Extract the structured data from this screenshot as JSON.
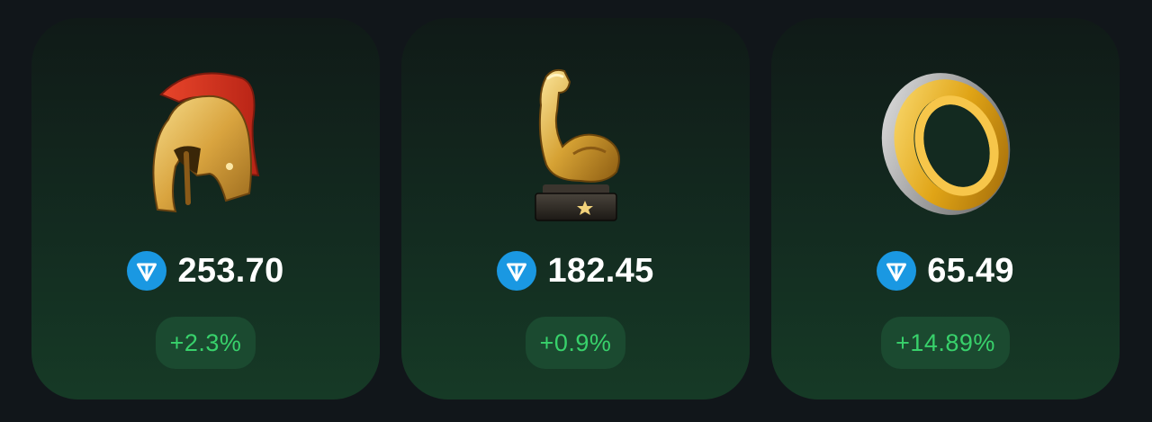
{
  "items": [
    {
      "icon": "spartan-helmet-icon",
      "price": "253.70",
      "change": "+2.3%"
    },
    {
      "icon": "flexed-bicep-trophy-icon",
      "price": "182.45",
      "change": "+0.9%"
    },
    {
      "icon": "gold-silver-ring-icon",
      "price": "65.49",
      "change": "+14.89%"
    }
  ],
  "currency_icon": "ton-diamond-icon",
  "colors": {
    "background": "#11161a",
    "card_top": "#101a17",
    "card_bottom": "#163a26",
    "price_text": "#ffffff",
    "change_text": "#38d16b",
    "change_pill": "#1b4a30",
    "ton_blue": "#1a98e2"
  }
}
